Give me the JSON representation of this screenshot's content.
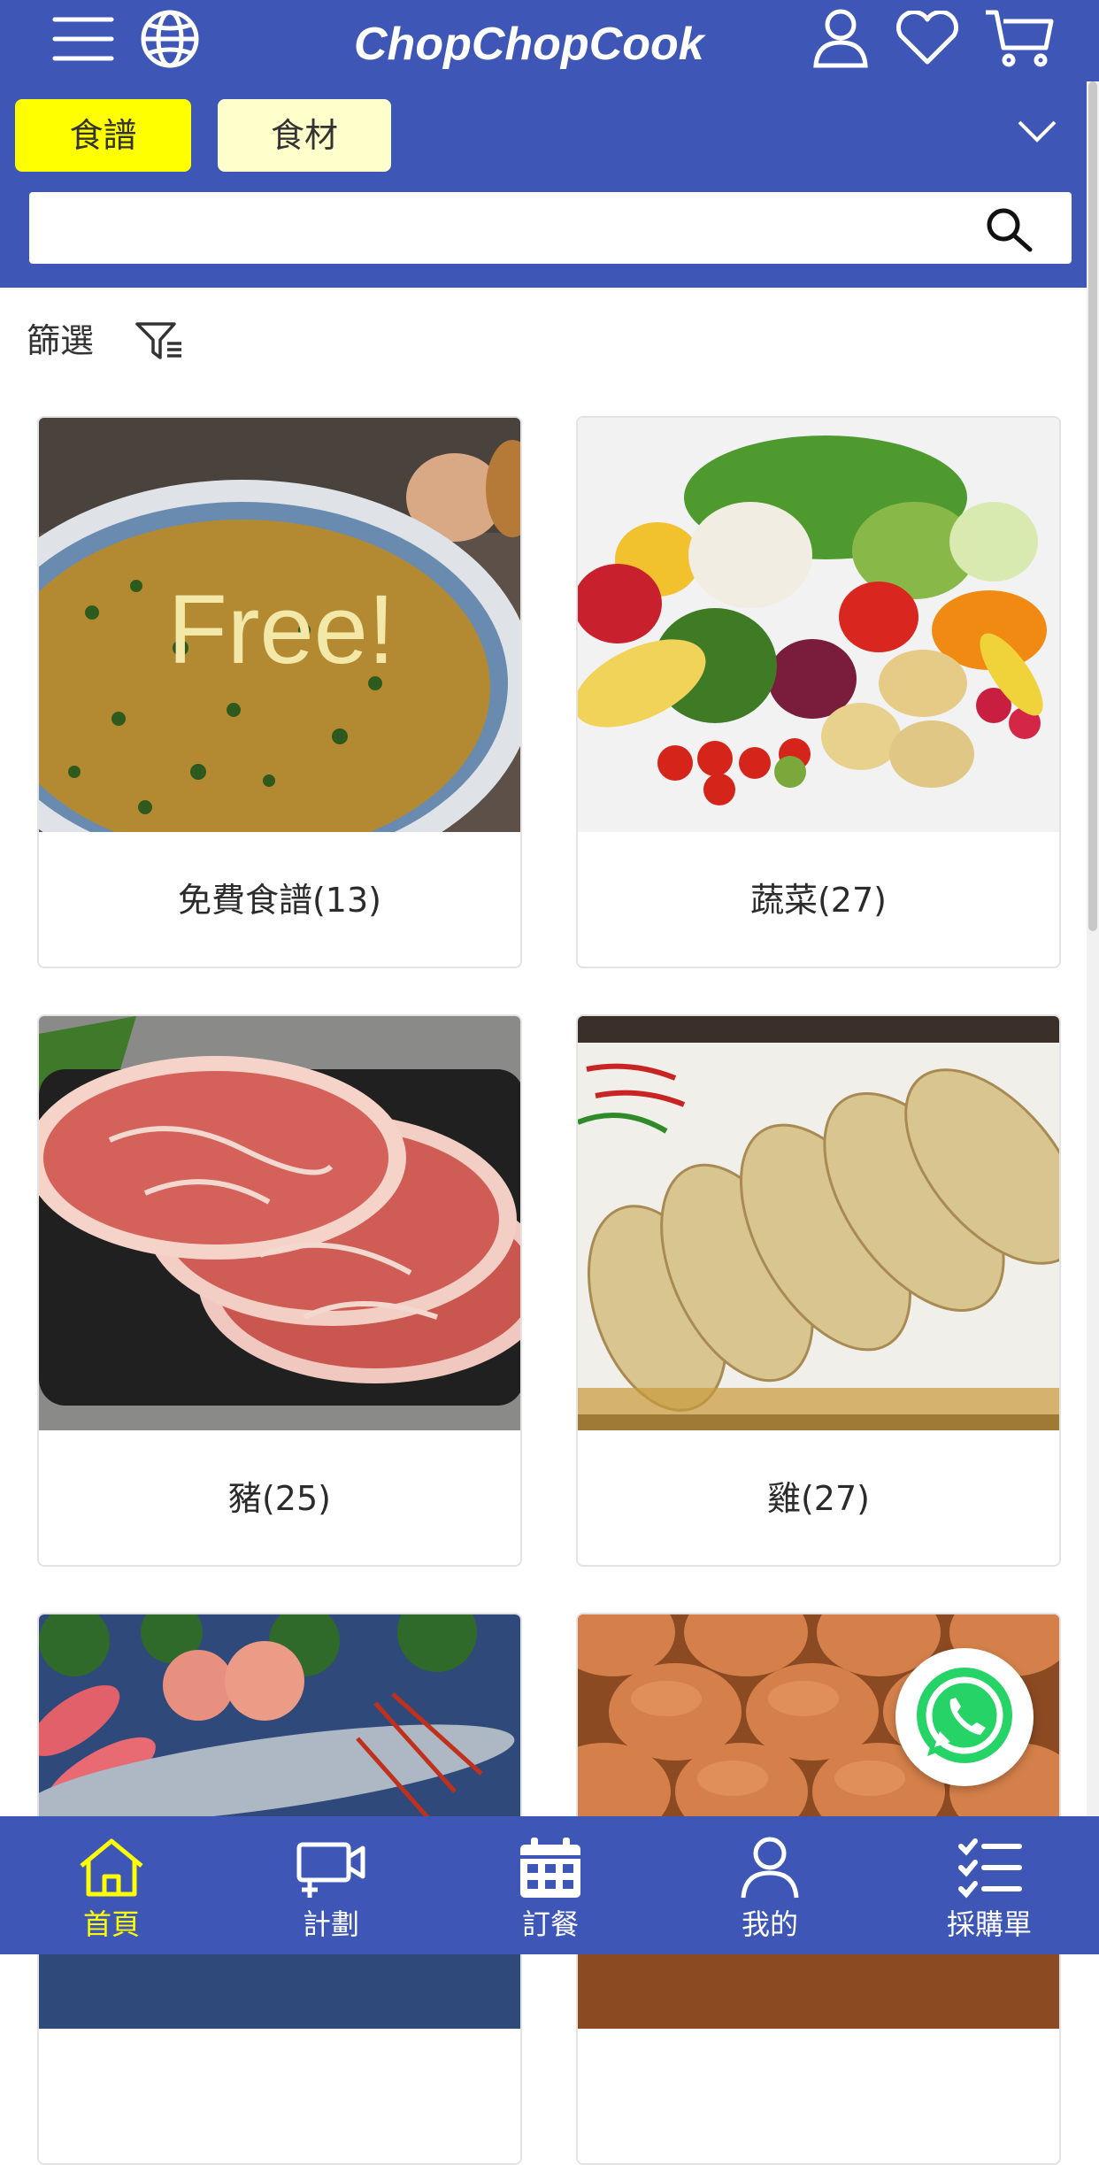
{
  "header": {
    "brand": "ChopChopCook",
    "icons": {
      "menu": "menu-icon",
      "language": "globe-icon",
      "account": "user-icon",
      "favorites": "heart-icon",
      "cart": "cart-icon",
      "expand": "chevron-down-icon",
      "search": "search-icon"
    },
    "tabs": [
      {
        "label": "食譜",
        "active": true
      },
      {
        "label": "食材",
        "active": false
      }
    ],
    "search": {
      "value": "",
      "placeholder": ""
    }
  },
  "filter": {
    "label": "篩選",
    "icon": "filter-icon"
  },
  "categories": [
    {
      "label": "免費食譜(13)",
      "image": "soup-bowl-image",
      "overlay_text": "Free!"
    },
    {
      "label": "蔬菜(27)",
      "image": "vegetables-image"
    },
    {
      "label": "豬(25)",
      "image": "pork-slices-image"
    },
    {
      "label": "雞(27)",
      "image": "sliced-chicken-image"
    },
    {
      "label": "",
      "image": "seafood-image"
    },
    {
      "label": "",
      "image": "eggs-image"
    }
  ],
  "bottom_nav": [
    {
      "label": "首頁",
      "icon": "home-icon",
      "active": true
    },
    {
      "label": "計劃",
      "icon": "plan-icon",
      "active": false
    },
    {
      "label": "訂餐",
      "icon": "calendar-icon",
      "active": false
    },
    {
      "label": "我的",
      "icon": "user-icon",
      "active": false
    },
    {
      "label": "採購單",
      "icon": "checklist-icon",
      "active": false
    }
  ],
  "floating": {
    "whatsapp_icon": "whatsapp-icon"
  },
  "colors": {
    "primary": "#3e56b5",
    "tab_active": "#ffff00",
    "tab_inactive": "#ffffcc",
    "nav_active": "#ffff00",
    "whatsapp": "#25d366"
  }
}
